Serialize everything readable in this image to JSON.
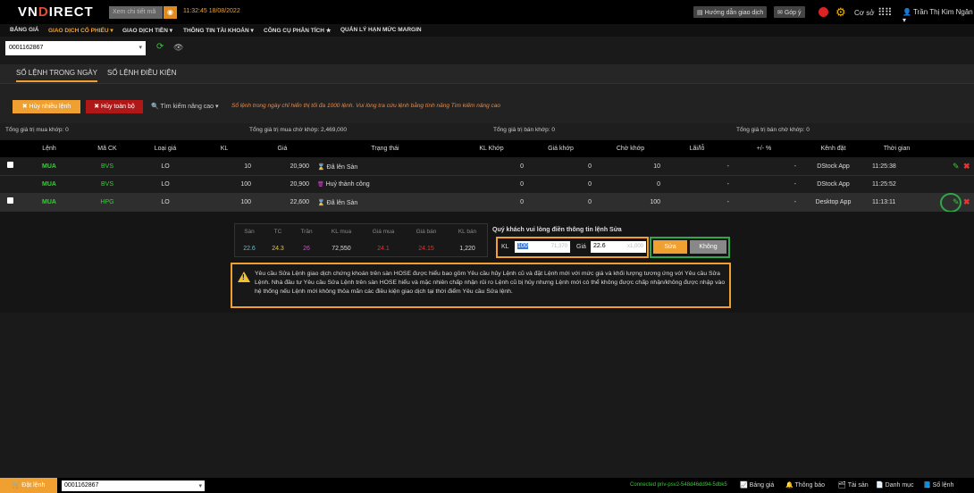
{
  "topbar": {
    "logo_a": "VN",
    "logo_b": "D",
    "logo_c": "IRECT",
    "search_placeholder": "Xem chi tiết mã",
    "time": "11:32:45",
    "date": "18/08/2022",
    "guide_label": "Hướng dẫn giao dịch",
    "feedback_label": "Góp ý",
    "mode_label": "Cơ sở",
    "user_name": "Trần Thị Kim Ngân"
  },
  "menu": [
    {
      "label": "BẢNG GIÁ"
    },
    {
      "label": "GIAO DỊCH CỔ PHIẾU ▾"
    },
    {
      "label": "GIAO DỊCH TIỀN ▾"
    },
    {
      "label": "THÔNG TIN TÀI KHOẢN ▾"
    },
    {
      "label": "CÔNG CỤ PHÂN TÍCH ★"
    },
    {
      "label": "QUẢN LÝ HẠN MỨC MARGIN"
    }
  ],
  "account": {
    "number": "0001162867"
  },
  "tabs": [
    {
      "label": "SỐ LỆNH TRONG NGÀY"
    },
    {
      "label": "SỐ LỆNH ĐIỀU KIỆN"
    }
  ],
  "actions": {
    "cancel_multi": "✖ Hủy nhiều lệnh",
    "cancel_all": "✖ Hủy toàn bộ",
    "adv_search": "Tìm kiếm nâng cao ▾",
    "note": "Sổ lệnh trong ngày chỉ hiển thị tối đa 1000 lệnh. Vui lòng tra cứu lệnh bằng tính năng Tìm kiếm nâng cao"
  },
  "totals": {
    "buy_matched": "Tổng giá trị mua khớp: 0",
    "buy_waiting": "Tổng giá trị mua chờ khớp: 2,469,000",
    "sell_matched": "Tổng giá trị bán khớp: 0",
    "sell_waiting": "Tổng giá trị bán chờ khớp: 0"
  },
  "table": {
    "headers": [
      "Lệnh",
      "Mã CK",
      "Loại giá",
      "KL",
      "Giá",
      "Trạng thái",
      "KL Khớp",
      "Giá khớp",
      "Chờ khớp",
      "Lãi/lỗ",
      "+/- %",
      "Kênh đặt",
      "Thời gian"
    ],
    "rows": [
      {
        "side": "MUA",
        "symbol": "BVS",
        "type": "LO",
        "qty": "10",
        "price": "20,900",
        "status": "Đã lên Sàn",
        "status_icon": "⌛",
        "matched_qty": "0",
        "matched_price": "0",
        "pending": "10",
        "pl": "-",
        "pct": "-",
        "channel": "DStock App",
        "time": "11:25:38"
      },
      {
        "side": "MUA",
        "symbol": "BVS",
        "type": "LO",
        "qty": "100",
        "price": "20,900",
        "status": "Huỷ thành công",
        "status_icon": "🗑",
        "matched_qty": "0",
        "matched_price": "0",
        "pending": "0",
        "pl": "-",
        "pct": "-",
        "channel": "DStock App",
        "time": "11:25:52"
      },
      {
        "side": "MUA",
        "symbol": "HPG",
        "type": "LO",
        "qty": "100",
        "price": "22,600",
        "status": "Đã lên Sàn",
        "status_icon": "⌛",
        "matched_qty": "0",
        "matched_price": "0",
        "pending": "100",
        "pl": "-",
        "pct": "-",
        "channel": "Desktop App",
        "time": "11:13:11"
      }
    ]
  },
  "edit": {
    "headers": [
      "Sàn",
      "TC",
      "Trần",
      "KL mua",
      "Giá mua",
      "Giá bán",
      "KL bán"
    ],
    "values": [
      "22.6",
      "24.3",
      "26",
      "72,550",
      "24.1",
      "24.15",
      "1,220"
    ],
    "value_colors": [
      "#4ac8e8",
      "#f0c030",
      "#e040e0",
      "#dddddd",
      "#e83030",
      "#e83030",
      "#dddddd"
    ],
    "prompt": "Quý khách vui lòng điền thông tin lệnh Sửa",
    "kl_label": "KL",
    "kl_value": "100",
    "kl_hint": "71,370",
    "gia_label": "Giá",
    "gia_value": "22.6",
    "gia_hint": "x1,000",
    "confirm": "Sửa",
    "cancel": "Không",
    "notice": "Yêu cầu Sửa Lệnh giao dịch chứng khoán trên sàn HOSE được hiểu bao gồm Yêu cầu hủy Lệnh cũ và đặt Lệnh mới với mức giá và khối lượng tương ứng với Yêu cầu Sửa Lệnh. Nhà đầu tư Yêu cầu Sửa Lệnh trên sàn HOSE hiểu và mặc nhiên chấp nhận rủi ro Lệnh cũ bị hủy nhưng Lệnh mới có thể không được chấp nhận/không được nhập vào hệ thống nếu Lệnh mới không thỏa mãn các điều kiện giao dịch tại thời điểm Yêu cầu Sửa lệnh."
  },
  "bottom": {
    "order_button": "🛒 Đặt lệnh",
    "account": "0001162867",
    "connection": "Connected priv-psv2-548d46dd94-5dbk5",
    "items": [
      {
        "label": "📈 Bảng giá"
      },
      {
        "label": "🔔 Thông báo"
      },
      {
        "label": "🗂 Tài sản"
      },
      {
        "label": "📄 Danh mục"
      },
      {
        "label": "📘 Sổ lệnh"
      }
    ]
  }
}
